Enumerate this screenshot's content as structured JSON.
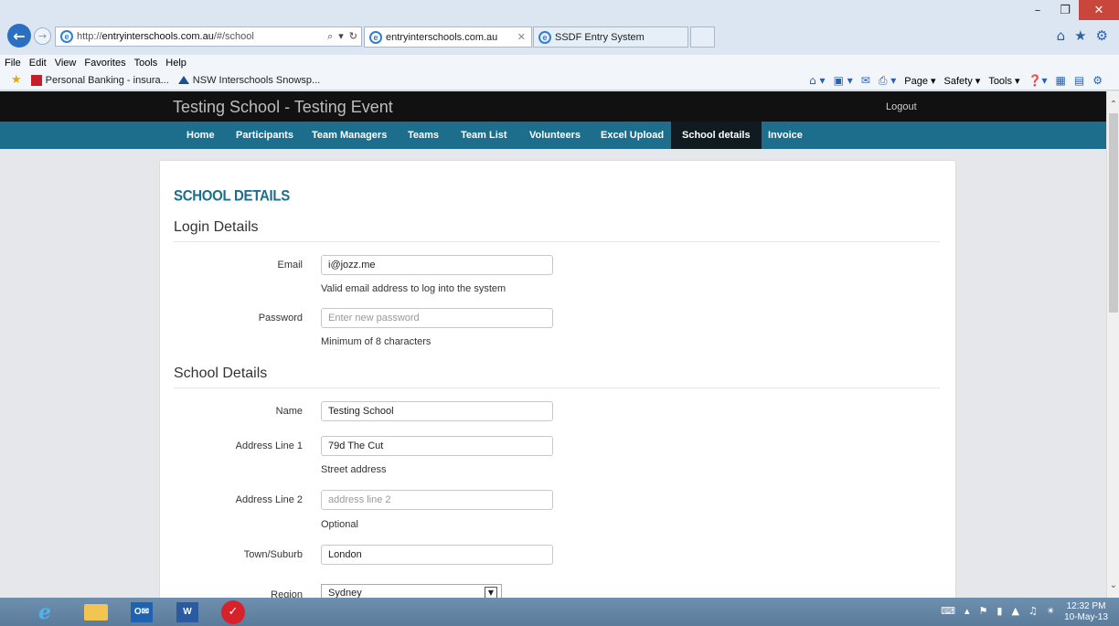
{
  "browser": {
    "url_prefix": "http://",
    "url_host": "entryinterschools.com.au",
    "url_path": "/#/school",
    "tab_active_title": "entryinterschools.com.au",
    "tab_inactive_title": "SSDF Entry System",
    "menu": [
      "File",
      "Edit",
      "View",
      "Favorites",
      "Tools",
      "Help"
    ],
    "favorites": [
      "Personal Banking - insura...",
      "NSW Interschools Snowsp..."
    ],
    "commands": [
      "Page ▾",
      "Safety ▾",
      "Tools ▾"
    ]
  },
  "site": {
    "title": "Testing School - Testing Event",
    "logout": "Logout",
    "nav": [
      "Home",
      "Participants",
      "Team Managers",
      "Teams",
      "Team List",
      "Volunteers",
      "Excel Upload",
      "School details",
      "Invoice"
    ],
    "active_nav": "School details"
  },
  "form": {
    "heading": "SCHOOL DETAILS",
    "login_section": "Login Details",
    "email_label": "Email",
    "email_value": "i@jozz.me",
    "email_help": "Valid email address to log into the system",
    "password_label": "Password",
    "password_placeholder": "Enter new password",
    "password_help": "Minimum of 8 characters",
    "school_section": "School Details",
    "name_label": "Name",
    "name_value": "Testing School",
    "address1_label": "Address Line 1",
    "address1_value": "79d The Cut",
    "address1_help": "Street address",
    "address2_label": "Address Line 2",
    "address2_placeholder": "address line 2",
    "address2_help": "Optional",
    "town_label": "Town/Suburb",
    "town_value": "London",
    "region_label": "Region",
    "region_value": "Sydney"
  },
  "taskbar": {
    "time": "12:32 PM",
    "date": "10-May-13"
  },
  "colors": {
    "nav_bg": "#1c6e8c",
    "header_bg": "#111111",
    "heading": "#1c6e8c"
  }
}
